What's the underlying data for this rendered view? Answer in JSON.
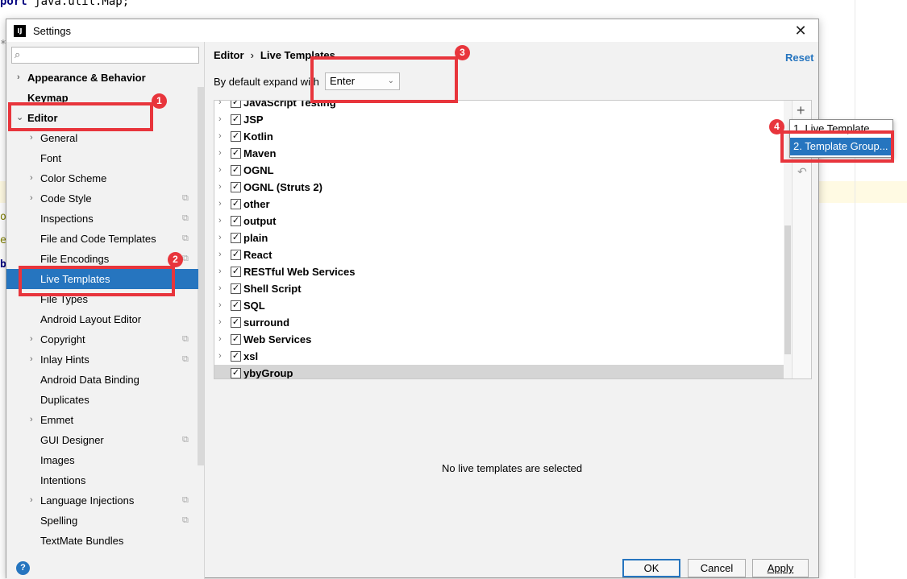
{
  "background": {
    "code_keyword": "port",
    "code_text": " java.util.Map;",
    "frag_star": "*",
    "frag_o": "o",
    "frag_e": "e",
    "frag_b": "b"
  },
  "dialog": {
    "app_icon": "IJ",
    "title": "Settings",
    "close_icon": "✕"
  },
  "sidebar": {
    "search_placeholder": "",
    "search_icon": "⌕",
    "items": [
      {
        "label": "Appearance & Behavior"
      },
      {
        "label": "Keymap"
      },
      {
        "label": "Editor"
      },
      {
        "label": "General"
      },
      {
        "label": "Font"
      },
      {
        "label": "Color Scheme"
      },
      {
        "label": "Code Style"
      },
      {
        "label": "Inspections"
      },
      {
        "label": "File and Code Templates"
      },
      {
        "label": "File Encodings"
      },
      {
        "label": "Live Templates"
      },
      {
        "label": "File Types"
      },
      {
        "label": "Android Layout Editor"
      },
      {
        "label": "Copyright"
      },
      {
        "label": "Inlay Hints"
      },
      {
        "label": "Android Data Binding"
      },
      {
        "label": "Duplicates"
      },
      {
        "label": "Emmet"
      },
      {
        "label": "GUI Designer"
      },
      {
        "label": "Images"
      },
      {
        "label": "Intentions"
      },
      {
        "label": "Language Injections"
      },
      {
        "label": "Spelling"
      },
      {
        "label": "TextMate Bundles"
      }
    ],
    "help_icon": "?"
  },
  "main": {
    "breadcrumb_parent": "Editor",
    "breadcrumb_sep": "›",
    "breadcrumb_current": "Live Templates",
    "reset_label": "Reset",
    "expand_label": "By default expand with",
    "expand_value": "Enter",
    "expand_caret": "⌄",
    "tree": [
      {
        "label": "JavaScript Testing",
        "checked": "✓"
      },
      {
        "label": "JSP",
        "checked": "✓"
      },
      {
        "label": "Kotlin",
        "checked": "✓"
      },
      {
        "label": "Maven",
        "checked": "✓"
      },
      {
        "label": "OGNL",
        "checked": "✓"
      },
      {
        "label": "OGNL (Struts 2)",
        "checked": "✓"
      },
      {
        "label": "other",
        "checked": "✓"
      },
      {
        "label": "output",
        "checked": "✓"
      },
      {
        "label": "plain",
        "checked": "✓"
      },
      {
        "label": "React",
        "checked": "✓"
      },
      {
        "label": "RESTful Web Services",
        "checked": "✓"
      },
      {
        "label": "Shell Script",
        "checked": "✓"
      },
      {
        "label": "SQL",
        "checked": "✓"
      },
      {
        "label": "surround",
        "checked": "✓"
      },
      {
        "label": "Web Services",
        "checked": "✓"
      },
      {
        "label": "xsl",
        "checked": "✓"
      },
      {
        "label": "ybyGroup",
        "checked": "✓"
      }
    ],
    "chevron": "›",
    "toolbar_plus": "+",
    "toolbar_undo": "↶",
    "empty_message": "No live templates are selected",
    "popup_item_1": "1. Live Template",
    "popup_item_2": "2. Template Group...",
    "ok_label": "OK",
    "cancel_label": "Cancel",
    "apply_label": "Apply"
  },
  "annotations": {
    "badge_1": "1",
    "badge_2": "2",
    "badge_3": "3",
    "badge_4": "4"
  },
  "colors": {
    "selection": "#2675bf",
    "annotation": "#e8353c",
    "link": "#2675bf"
  }
}
